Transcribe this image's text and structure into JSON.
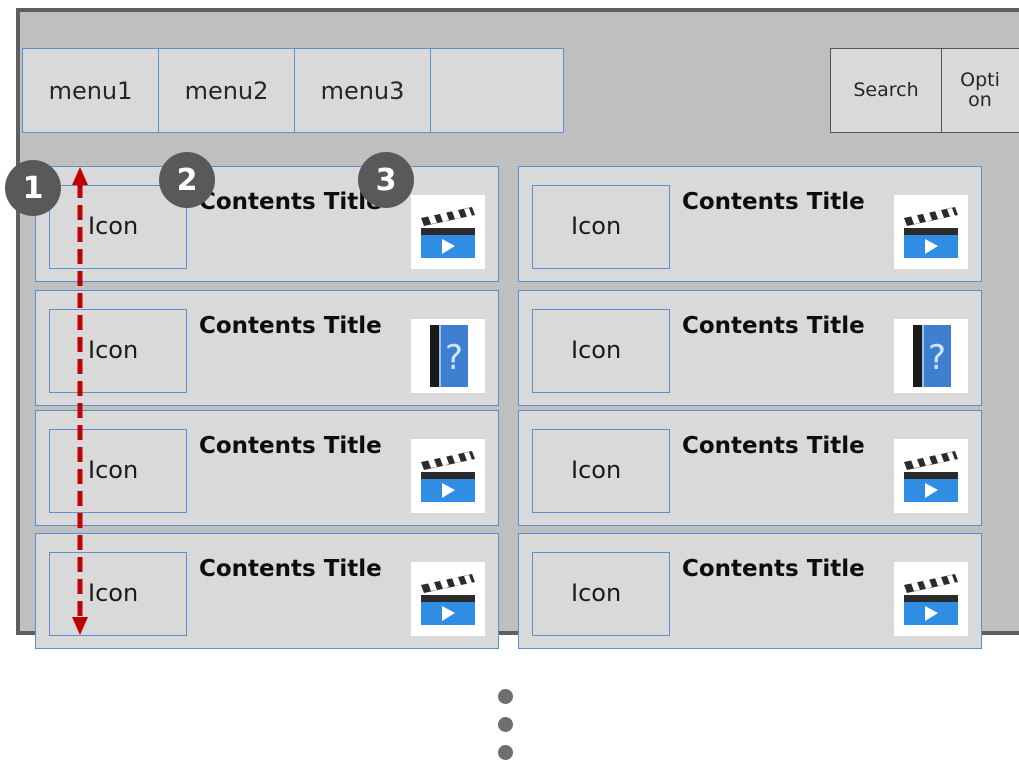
{
  "menu": {
    "items": [
      {
        "label": "menu1"
      },
      {
        "label": "menu2"
      },
      {
        "label": "menu3"
      },
      {
        "label": ""
      }
    ]
  },
  "toolbar": {
    "search_label": "Search",
    "option_label": "Opti\non"
  },
  "callouts": [
    "1",
    "2",
    "3"
  ],
  "cards": [
    {
      "icon_label": "Icon",
      "title": "Contents Title",
      "thumb": "video-clapperboard-icon"
    },
    {
      "icon_label": "Icon",
      "title": "Contents Title",
      "thumb": "video-clapperboard-icon"
    },
    {
      "icon_label": "Icon",
      "title": "Contents Title",
      "thumb": "help-book-icon"
    },
    {
      "icon_label": "Icon",
      "title": "Contents Title",
      "thumb": "help-book-icon"
    },
    {
      "icon_label": "Icon",
      "title": "Contents Title",
      "thumb": "video-clapperboard-icon"
    },
    {
      "icon_label": "Icon",
      "title": "Contents Title",
      "thumb": "video-clapperboard-icon"
    },
    {
      "icon_label": "Icon",
      "title": "Contents Title",
      "thumb": "video-clapperboard-icon"
    },
    {
      "icon_label": "Icon",
      "title": "Contents Title",
      "thumb": "video-clapperboard-icon"
    }
  ],
  "colors": {
    "frame_bg": "#bfbfbf",
    "panel_bg": "#d9d9d9",
    "border_blue": "#5b8fd4",
    "badge": "#595959",
    "scroll_arrow": "#c00000"
  }
}
